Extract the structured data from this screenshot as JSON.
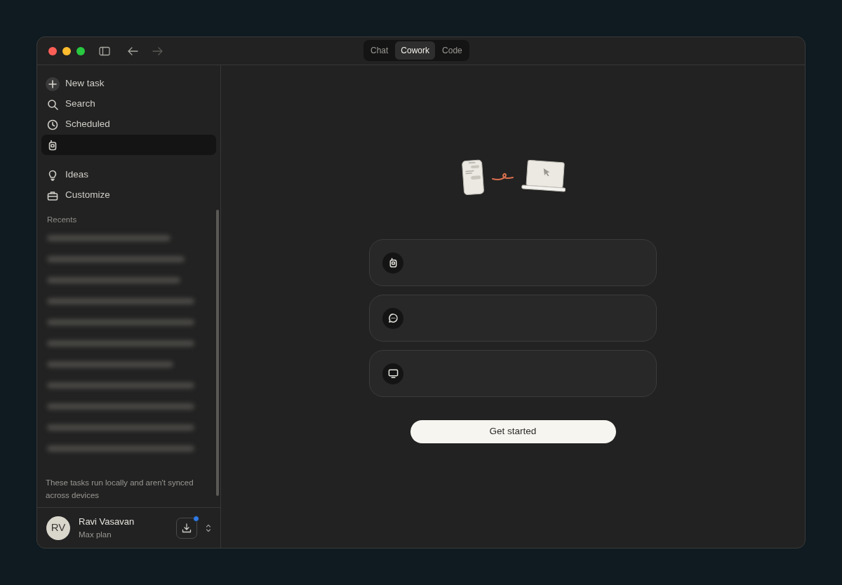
{
  "mode_tabs": [
    {
      "label": "Chat",
      "selected": false
    },
    {
      "label": "Cowork",
      "selected": true
    },
    {
      "label": "Code",
      "selected": false
    }
  ],
  "sidebar": {
    "nav": [
      {
        "kind": "new",
        "label": "New task",
        "selected": false
      },
      {
        "kind": "search",
        "label": "Search",
        "selected": false
      },
      {
        "kind": "clock",
        "label": "Scheduled",
        "selected": false
      },
      {
        "kind": "robot",
        "selected": true
      },
      {
        "kind": "bulb",
        "label": "Ideas",
        "selected": false
      },
      {
        "kind": "toolbox",
        "label": "Customize",
        "selected": false
      }
    ],
    "recents_label": "Recents",
    "recents": [
      {
        "kind": "blurred"
      },
      {
        "kind": "blurred"
      },
      {
        "kind": "blurred"
      },
      {
        "kind": "blurred"
      },
      {
        "kind": "blurred"
      },
      {
        "kind": "blurred"
      },
      {
        "kind": "blurred"
      },
      {
        "kind": "blurred"
      },
      {
        "kind": "blurred"
      },
      {
        "kind": "blurred"
      },
      {
        "kind": "blurred"
      }
    ],
    "note": "These tasks run locally and aren't synced across devices",
    "user": {
      "initials": "RV",
      "name": "Ravi Vasavan",
      "plan": "Max plan",
      "update_badge": true
    }
  },
  "options": [
    {
      "kind": "robot"
    },
    {
      "kind": "chat"
    },
    {
      "kind": "monitor"
    }
  ],
  "primary_button": "Get started"
}
